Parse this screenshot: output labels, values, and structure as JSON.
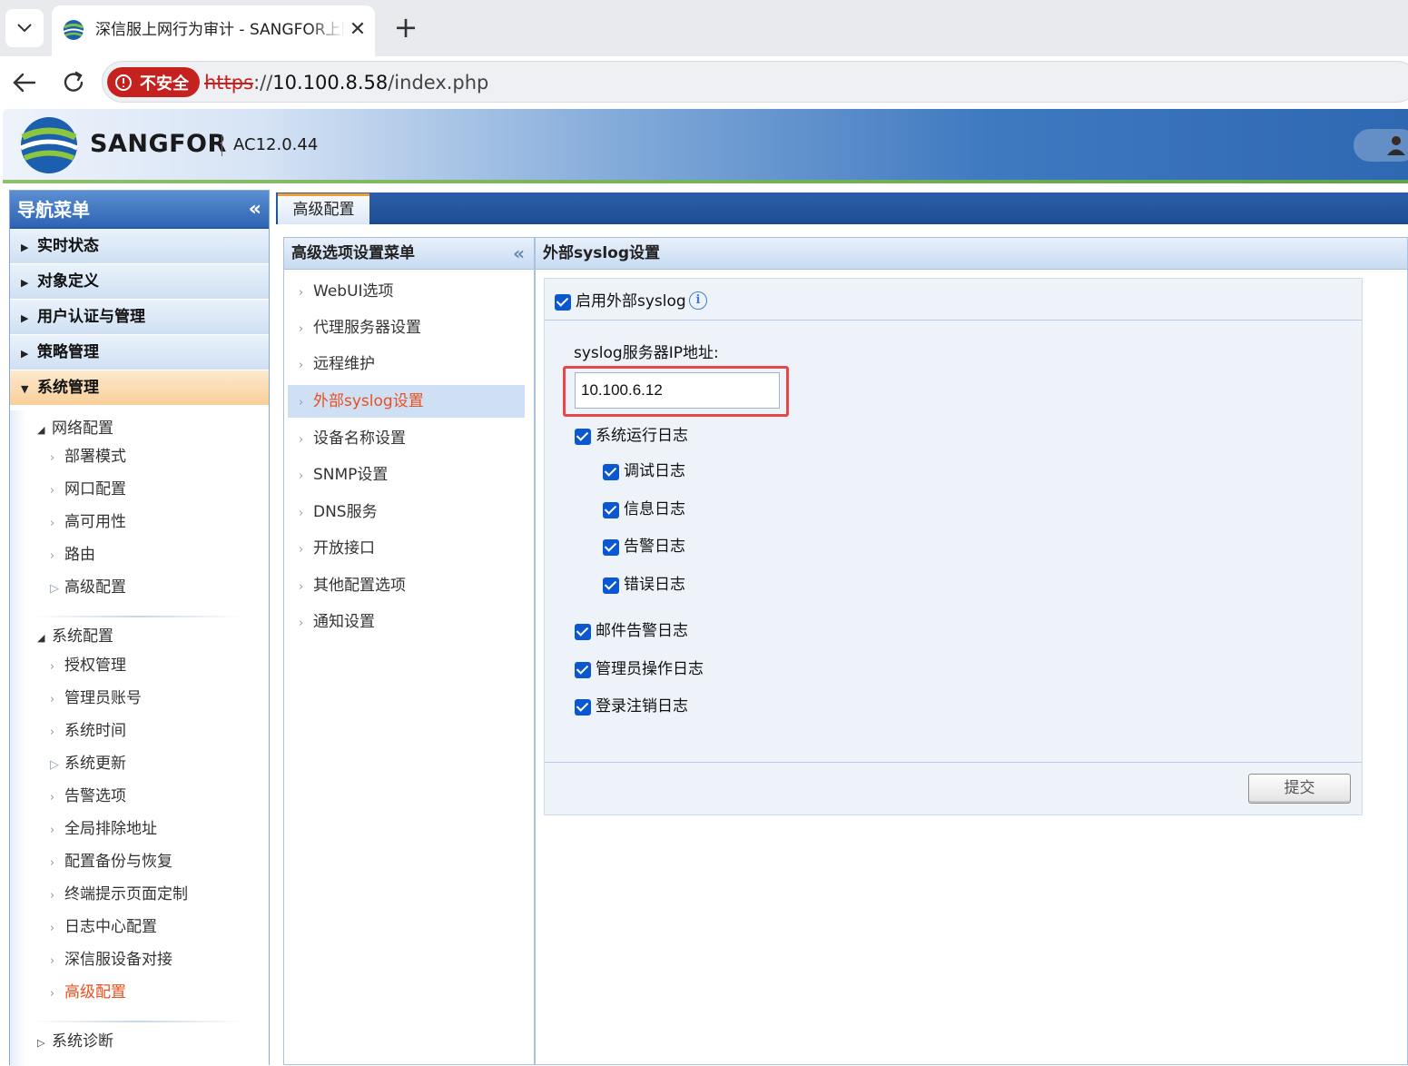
{
  "browser": {
    "tab_title": "深信服上网行为审计 - SANGFOR上网行为审计",
    "close_glyph": "✕",
    "new_tab_glyph": "+",
    "security_label": "不安全",
    "url_scheme": "https",
    "url_rest": "://",
    "url_host": "10.100.8.58",
    "url_path": "/index.php"
  },
  "header": {
    "brand": "SANGFOR",
    "version": "AC12.0.44"
  },
  "leftnav": {
    "title": "导航菜单",
    "collapse_glyph": "«",
    "categories": [
      {
        "label": "实时状态",
        "arrow": "▶"
      },
      {
        "label": "对象定义",
        "arrow": "▶"
      },
      {
        "label": "用户认证与管理",
        "arrow": "▶"
      },
      {
        "label": "策略管理",
        "arrow": "▶"
      },
      {
        "label": "系统管理",
        "arrow": "▼"
      }
    ],
    "groups": {
      "network": {
        "label": "网络配置",
        "tri": "◢"
      },
      "system": {
        "label": "系统配置",
        "tri": "◢"
      },
      "diag": {
        "label": "系统诊断",
        "tri": "▷"
      }
    },
    "network_items": [
      {
        "label": "部署模式",
        "ch": "›"
      },
      {
        "label": "网口配置",
        "ch": "›"
      },
      {
        "label": "高可用性",
        "ch": "›"
      },
      {
        "label": "路由",
        "ch": "›"
      },
      {
        "label": "高级配置",
        "ch": "▷"
      }
    ],
    "system_items": [
      {
        "label": "授权管理",
        "ch": "›"
      },
      {
        "label": "管理员账号",
        "ch": "›"
      },
      {
        "label": "系统时间",
        "ch": "›"
      },
      {
        "label": "系统更新",
        "ch": "▷"
      },
      {
        "label": "告警选项",
        "ch": "›"
      },
      {
        "label": "全局排除地址",
        "ch": "›"
      },
      {
        "label": "配置备份与恢复",
        "ch": "›"
      },
      {
        "label": "终端提示页面定制",
        "ch": "›"
      },
      {
        "label": "日志中心配置",
        "ch": "›"
      },
      {
        "label": "深信服设备对接",
        "ch": "›"
      },
      {
        "label": "高级配置",
        "ch": "›"
      }
    ]
  },
  "main": {
    "tab_label": "高级配置",
    "submenu": {
      "title": "高级选项设置菜单",
      "collapse_glyph": "«",
      "items": [
        {
          "label": "WebUI选项",
          "ch": "›"
        },
        {
          "label": "代理服务器设置",
          "ch": "›"
        },
        {
          "label": "远程维护",
          "ch": "›"
        },
        {
          "label": "外部syslog设置",
          "ch": "›"
        },
        {
          "label": "设备名称设置",
          "ch": "›"
        },
        {
          "label": "SNMP设置",
          "ch": "›"
        },
        {
          "label": "DNS服务",
          "ch": "›"
        },
        {
          "label": "开放接口",
          "ch": "›"
        },
        {
          "label": "其他配置选项",
          "ch": "›"
        },
        {
          "label": "通知设置",
          "ch": "›"
        }
      ]
    },
    "panel": {
      "title": "外部syslog设置",
      "enable_label": "启用外部syslog",
      "info_glyph": "i",
      "ip_label": "syslog服务器IP地址:",
      "ip_value": "10.100.6.12",
      "log_types": {
        "system_run": "系统运行日志",
        "debug": "调试日志",
        "info": "信息日志",
        "warn": "告警日志",
        "error": "错误日志",
        "mail": "邮件告警日志",
        "admin_op": "管理员操作日志",
        "login": "登录注销日志"
      },
      "submit_label": "提交"
    }
  },
  "colors": {
    "accent_blue": "#2e64b3",
    "active_orange": "#f9cf99",
    "selected_text": "#e8501f",
    "insecure_red": "#c5221f",
    "checkbox_blue": "#0b57d0",
    "highlight_red": "#e8474a"
  }
}
